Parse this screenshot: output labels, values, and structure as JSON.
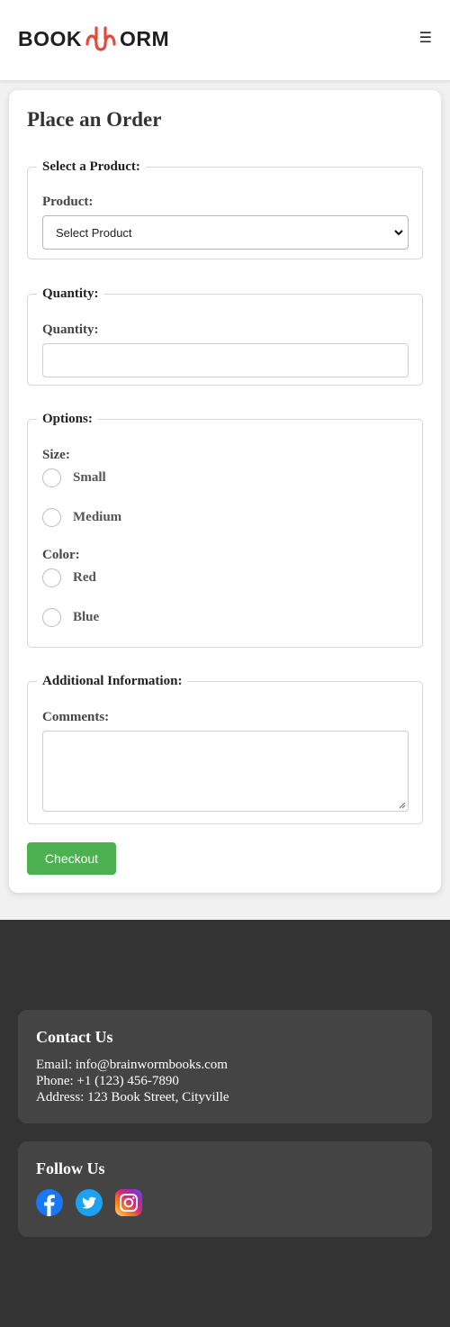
{
  "header": {
    "logo_left": "BOOK",
    "logo_right": "ORM",
    "menu_icon": "☰"
  },
  "form": {
    "title": "Place an Order",
    "product_section": {
      "legend": "Select a Product:",
      "label": "Product:",
      "selected": "Select Product"
    },
    "quantity_section": {
      "legend": "Quantity:",
      "label": "Quantity:",
      "value": ""
    },
    "options_section": {
      "legend": "Options:",
      "size_label": "Size:",
      "sizes": [
        "Small",
        "Medium"
      ],
      "color_label": "Color:",
      "colors": [
        "Red",
        "Blue"
      ]
    },
    "additional_section": {
      "legend": "Additional Information:",
      "label": "Comments:",
      "value": ""
    },
    "checkout_label": "Checkout"
  },
  "footer": {
    "contact": {
      "title": "Contact Us",
      "email": "Email: info@brainwormbooks.com",
      "phone": "Phone: +1 (123) 456-7890",
      "address": "Address: 123 Book Street, Cityville"
    },
    "follow": {
      "title": "Follow Us",
      "icons": [
        "facebook-icon",
        "twitter-icon",
        "instagram-icon"
      ]
    }
  },
  "colors": {
    "accent_green": "#4caf50",
    "logo_red": "#e04b3c",
    "footer_bg": "#333333",
    "footer_box": "#444444",
    "facebook_blue": "#1877f2",
    "twitter_blue": "#1da1f2"
  }
}
